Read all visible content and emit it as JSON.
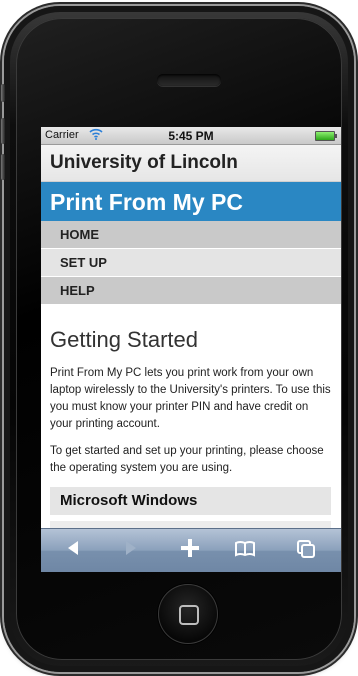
{
  "status_bar": {
    "carrier": "Carrier",
    "time": "5:45 PM"
  },
  "header": {
    "site_title": "University of Lincoln"
  },
  "banner": {
    "title": "Print From My PC",
    "color": "#2a87c3"
  },
  "nav": {
    "items": [
      {
        "label": "HOME"
      },
      {
        "label": "SET UP"
      },
      {
        "label": "HELP"
      }
    ]
  },
  "main": {
    "heading": "Getting Started",
    "paragraphs": [
      "Print From My PC lets you print work from your own laptop wirelessly to the University's printers. To use this you must know your printer PIN and have credit on your printing account.",
      "To get started and set up your printing, please choose the operating system you are using."
    ],
    "os_options": [
      {
        "label": "Microsoft Windows"
      }
    ]
  },
  "toolbar": {
    "icons": [
      "back-icon",
      "forward-icon",
      "add-icon",
      "bookmarks-icon",
      "pages-icon"
    ]
  }
}
